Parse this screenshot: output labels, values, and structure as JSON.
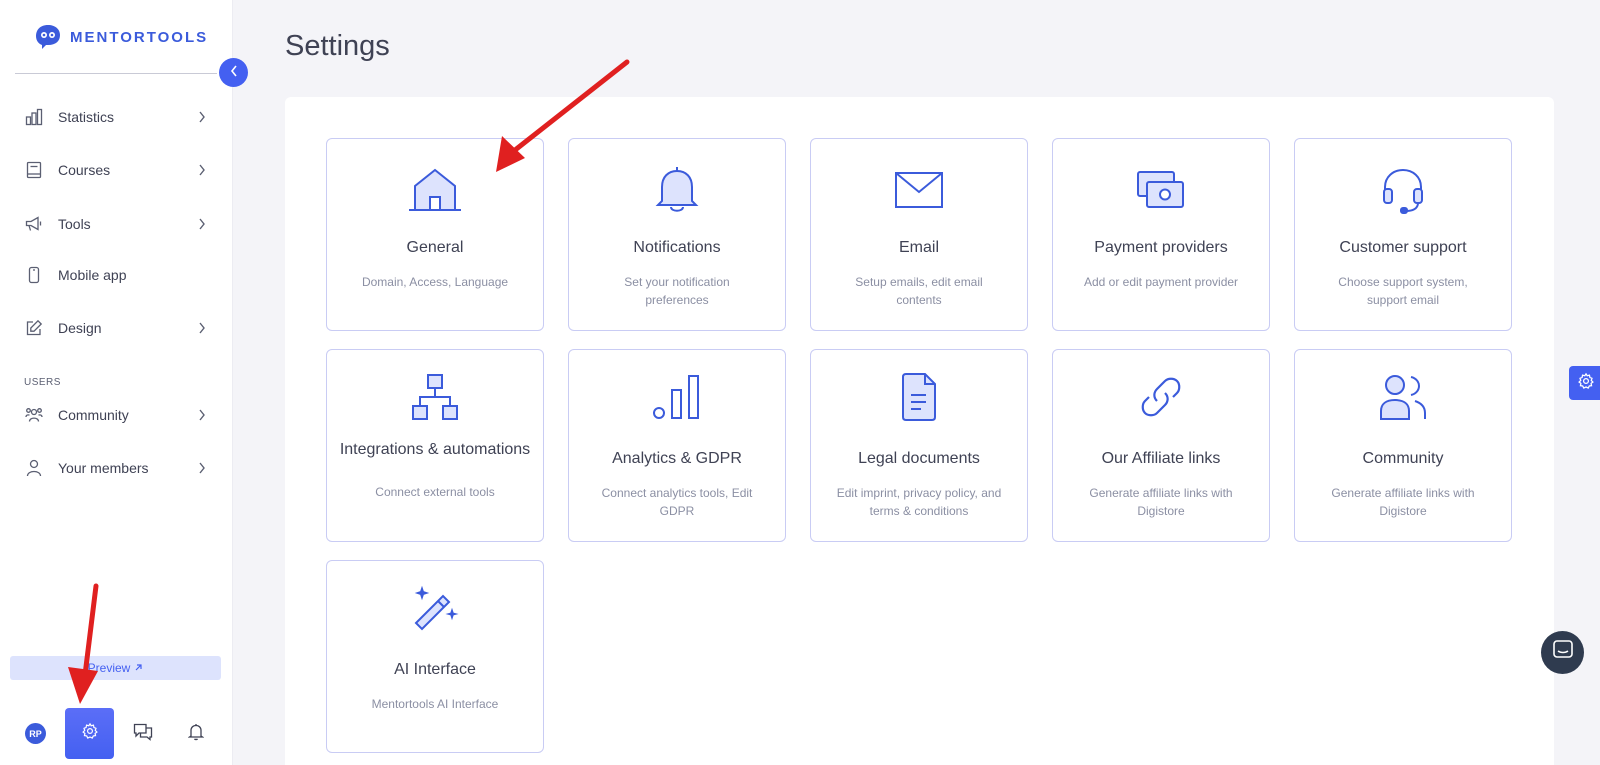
{
  "brand": {
    "name": "MENTORTOOLS",
    "color": "#3b5bdb"
  },
  "colors": {
    "accent": "#4460f1",
    "card_border": "#c9ccf4",
    "annotation_arrow": "#e02020"
  },
  "sidebar": {
    "items": [
      {
        "label": "Statistics",
        "icon": "bar-chart-icon",
        "has_chevron": true
      },
      {
        "label": "Courses",
        "icon": "book-icon",
        "has_chevron": true
      },
      {
        "label": "Tools",
        "icon": "megaphone-icon",
        "has_chevron": true
      },
      {
        "label": "Mobile app",
        "icon": "phone-icon",
        "has_chevron": false
      },
      {
        "label": "Design",
        "icon": "pencil-square-icon",
        "has_chevron": true
      }
    ],
    "users_section_label": "USERS",
    "user_items": [
      {
        "label": "Community",
        "icon": "group-icon",
        "has_chevron": true
      },
      {
        "label": "Your members",
        "icon": "user-icon",
        "has_chevron": true
      }
    ],
    "preview_label": "Preview",
    "preview_icon": "external-arrow-icon",
    "avatar_initials": "RP",
    "bottom_icons": [
      "settings-gear-icon",
      "chat-bubbles-icon",
      "bell-icon"
    ]
  },
  "main": {
    "title": "Settings",
    "cards": [
      {
        "title": "General",
        "desc": "Domain, Access, Language",
        "icon": "home-icon"
      },
      {
        "title": "Notifications",
        "desc": "Set your notification preferences",
        "icon": "bell-icon"
      },
      {
        "title": "Email",
        "desc": "Setup emails, edit email contents",
        "icon": "envelope-icon"
      },
      {
        "title": "Payment providers",
        "desc": "Add or edit payment provider",
        "icon": "cash-icon"
      },
      {
        "title": "Customer support",
        "desc": "Choose support system, support email",
        "icon": "headset-icon"
      },
      {
        "title": "Integrations & automations",
        "desc": "Connect external tools",
        "icon": "hierarchy-icon"
      },
      {
        "title": "Analytics & GDPR",
        "desc": "Connect analytics tools, Edit GDPR",
        "icon": "signal-bars-icon"
      },
      {
        "title": "Legal documents",
        "desc": "Edit imprint, privacy policy, and terms & conditions",
        "icon": "document-icon"
      },
      {
        "title": "Our Affiliate links",
        "desc": "Generate affiliate links with Digistore",
        "icon": "link-icon"
      },
      {
        "title": "Community",
        "desc": "Generate affiliate links with Digistore",
        "icon": "users-icon"
      },
      {
        "title": "AI Interface",
        "desc": "Mentortools AI Interface",
        "icon": "magic-wand-icon"
      }
    ]
  }
}
